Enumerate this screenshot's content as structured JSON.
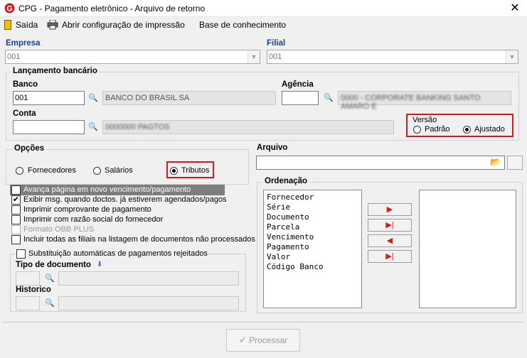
{
  "window": {
    "title": "CPG - Pagamento eletrônico - Arquivo de retorno",
    "close_glyph": "✕"
  },
  "menu": {
    "exit": "Saída",
    "print_config": "Abrir configuração de impressão",
    "knowledge_base": "Base de conhecimento"
  },
  "empresa": {
    "label": "Empresa",
    "value": "001"
  },
  "filial": {
    "label": "Filial",
    "value": "001"
  },
  "lancamento": {
    "title": "Lançamento bancário",
    "banco_label": "Banco",
    "banco_code": "001",
    "banco_name": "BANCO DO BRASIL SA",
    "agencia_label": "Agência",
    "agencia_code": "",
    "agencia_name": "0000 - CORPORATE BANKING SANTO AMARO E",
    "conta_label": "Conta",
    "conta_code": "",
    "conta_name": "0000000 PAGTOS",
    "versao_title": "Versão",
    "versao_options": [
      "Padrão",
      "Ajustado"
    ],
    "versao_selected": "Ajustado"
  },
  "opcoes": {
    "title": "Opções",
    "radios": [
      "Fornecedores",
      "Salários",
      "Tributos"
    ],
    "selected": "Tributos",
    "checks": [
      {
        "label": "Avança página em novo vencimento/pagamento",
        "checked": false,
        "highlighted": true
      },
      {
        "label": "Exibir msg. quando doctos. já estiverem agendados/pagos",
        "checked": true
      },
      {
        "label": "Imprimir comprovante de pagamento",
        "checked": false
      },
      {
        "label": "Imprimir com razão social do fornecedor",
        "checked": false
      },
      {
        "label": "Formato OBB PLUS",
        "checked": false,
        "disabled": true
      },
      {
        "label": "Incluir todas as filiais na listagem de documentos não processados",
        "checked": false
      }
    ],
    "subst_label": "Substituição automáticas de pagamentos rejeitados",
    "tipo_doc_label": "Tipo de documento",
    "historico_label": "Historico"
  },
  "arquivo": {
    "label": "Arquivo",
    "value": ""
  },
  "ordenacao": {
    "title": "Ordenação",
    "items": [
      "Fornecedor",
      "Série",
      "Documento",
      "Parcela",
      "Vencimento",
      "Pagamento",
      "Valor",
      "Código Banco"
    ],
    "selected_items": []
  },
  "footer": {
    "processar": "Processar"
  },
  "colors": {
    "accent_red": "#d7191f",
    "label_blue": "#1a3e99"
  }
}
